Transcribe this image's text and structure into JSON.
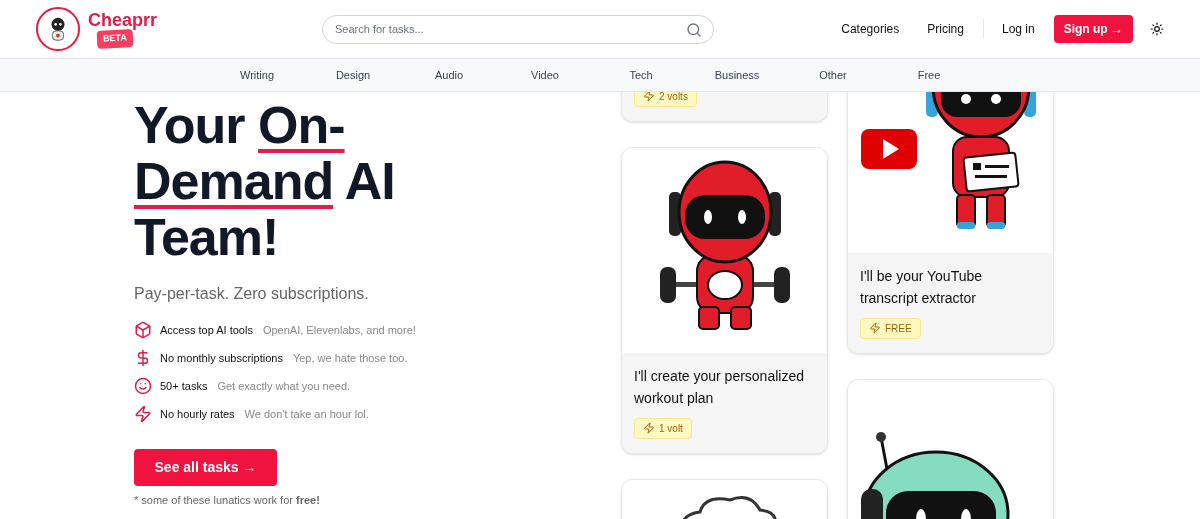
{
  "header": {
    "brand": "Cheaprr",
    "beta": "BETA",
    "search": {
      "placeholder": "Search for tasks..."
    },
    "links": [
      "Categories",
      "Pricing"
    ],
    "login": "Log in",
    "signup": "Sign up →"
  },
  "categories": [
    "Writing",
    "Design",
    "Audio",
    "Video",
    "Tech",
    "Business",
    "Other",
    "Free"
  ],
  "hero": {
    "headline": [
      {
        "text": "Your ",
        "highlight": false
      },
      {
        "text": "On-Demand",
        "highlight": true
      },
      {
        "text": " AI Team!",
        "highlight": false
      }
    ],
    "tagline": "Pay-per-task. Zero subscriptions.",
    "features": [
      {
        "kind": "box",
        "title": "Access top AI tools",
        "note": "OpenAI, Elevenlabs, and more!"
      },
      {
        "kind": "dollar",
        "title": "No monthly subscriptions",
        "note": "Yep, we hate those too."
      },
      {
        "kind": "smile",
        "title": "50+ tasks",
        "note": "Get exactly what you need."
      },
      {
        "kind": "bolt",
        "title": "No hourly rates",
        "note": "We don't take an hour lol."
      }
    ],
    "cta": "See all tasks →",
    "footnote": "* some of these lunatics work for **free!**"
  },
  "columns": [
    {
      "cards": [
        {
          "badge": "2 volts"
        },
        {
          "kind": "weights",
          "title": "I'll create your personalized workout plan",
          "badge": "1 volt"
        },
        {
          "kind": "chef"
        }
      ]
    },
    {
      "cards": [
        {
          "kind": "youtube",
          "title": "I'll be your YouTube transcript extractor",
          "badge": "FREE"
        },
        {
          "kind": "green"
        }
      ]
    }
  ]
}
